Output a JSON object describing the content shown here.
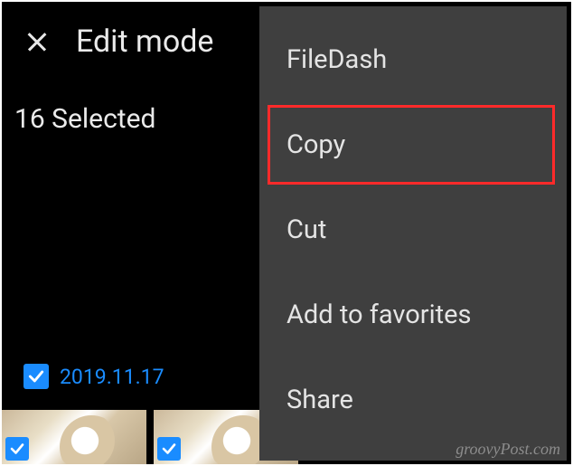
{
  "header": {
    "title": "Edit mode",
    "selection_text": "16 Selected"
  },
  "date_group": {
    "checked": true,
    "label": "2019.11.17"
  },
  "menu": {
    "items": [
      {
        "label": "FileDash",
        "highlight": false
      },
      {
        "label": "Copy",
        "highlight": true
      },
      {
        "label": "Cut",
        "highlight": false
      },
      {
        "label": "Add to favorites",
        "highlight": false
      },
      {
        "label": "Share",
        "highlight": false
      }
    ]
  },
  "watermark": "groovyPost.com"
}
